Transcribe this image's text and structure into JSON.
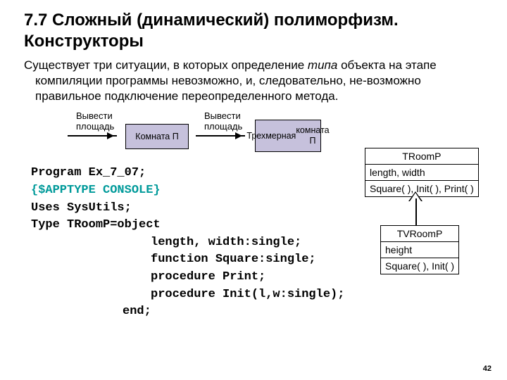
{
  "title": "7.7 Сложный (динамический) полиморфизм. Конструкторы",
  "para_pre": "Существует три ситуации, в которых определение ",
  "para_ital": "типа",
  "para_post": " объекта на этапе компиляции программы невозможно, и, следовательно, не-возможно правильное подключение переопределенного метода.",
  "d_label1a": "Вывести",
  "d_label1b": "площадь",
  "d_box1": "Комната П",
  "d_label2a": "Вывести",
  "d_label2b": "площадь",
  "d_box2a": "Трехмерная",
  "d_box2b": "комната П",
  "code": {
    "l1": "Program Ex_7_07;",
    "l2": "{$APPTYPE CONSOLE}",
    "l3": "Uses SysUtils;",
    "l4": "Type TRoomP=object",
    "l5": "length, width:single;",
    "l6": "function Square:single;",
    "l7": "procedure Print;",
    "l8": "procedure Init(l,w:single);",
    "l9": "end;"
  },
  "uml1": {
    "name": "TRoomP",
    "attrs": "length, width",
    "ops": "Square( ), Init( ), Print( )"
  },
  "uml2": {
    "name": "TVRoomP",
    "attrs": "height",
    "ops": "Square( ), Init( )"
  },
  "page": "42"
}
